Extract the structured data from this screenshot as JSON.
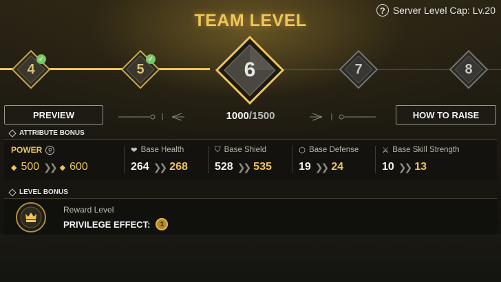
{
  "header": {
    "title": "TEAM LEVEL",
    "server_cap": "Server Level Cap: Lv.20"
  },
  "levels": [
    {
      "num": "4",
      "done": true
    },
    {
      "num": "5",
      "done": true
    },
    {
      "num": "6",
      "current": true
    },
    {
      "num": "7"
    },
    {
      "num": "8"
    }
  ],
  "buttons": {
    "preview": "PREVIEW",
    "how_to_raise": "HOW TO RAISE"
  },
  "progress": {
    "current": "1000",
    "max": "/1500"
  },
  "attribute_section": {
    "label": "ATTRIBUTE BONUS"
  },
  "attributes": {
    "power": {
      "label": "POWER",
      "from": "500",
      "to": "600"
    },
    "health": {
      "label": "Base Health",
      "from": "264",
      "to": "268"
    },
    "shield": {
      "label": "Base Shield",
      "from": "528",
      "to": "535"
    },
    "defense": {
      "label": "Base Defense",
      "from": "19",
      "to": "24"
    },
    "skill": {
      "label": "Base Skill Strength",
      "from": "10",
      "to": "13"
    }
  },
  "level_section": {
    "label": "LEVEL BONUS"
  },
  "level_bonus": {
    "reward_label": "Reward Level",
    "privilege_label": "PRIVILEGE EFFECT:",
    "privilege_value": "1"
  },
  "colors": {
    "gold": "#f0c65a",
    "check": "#7cc46a"
  }
}
